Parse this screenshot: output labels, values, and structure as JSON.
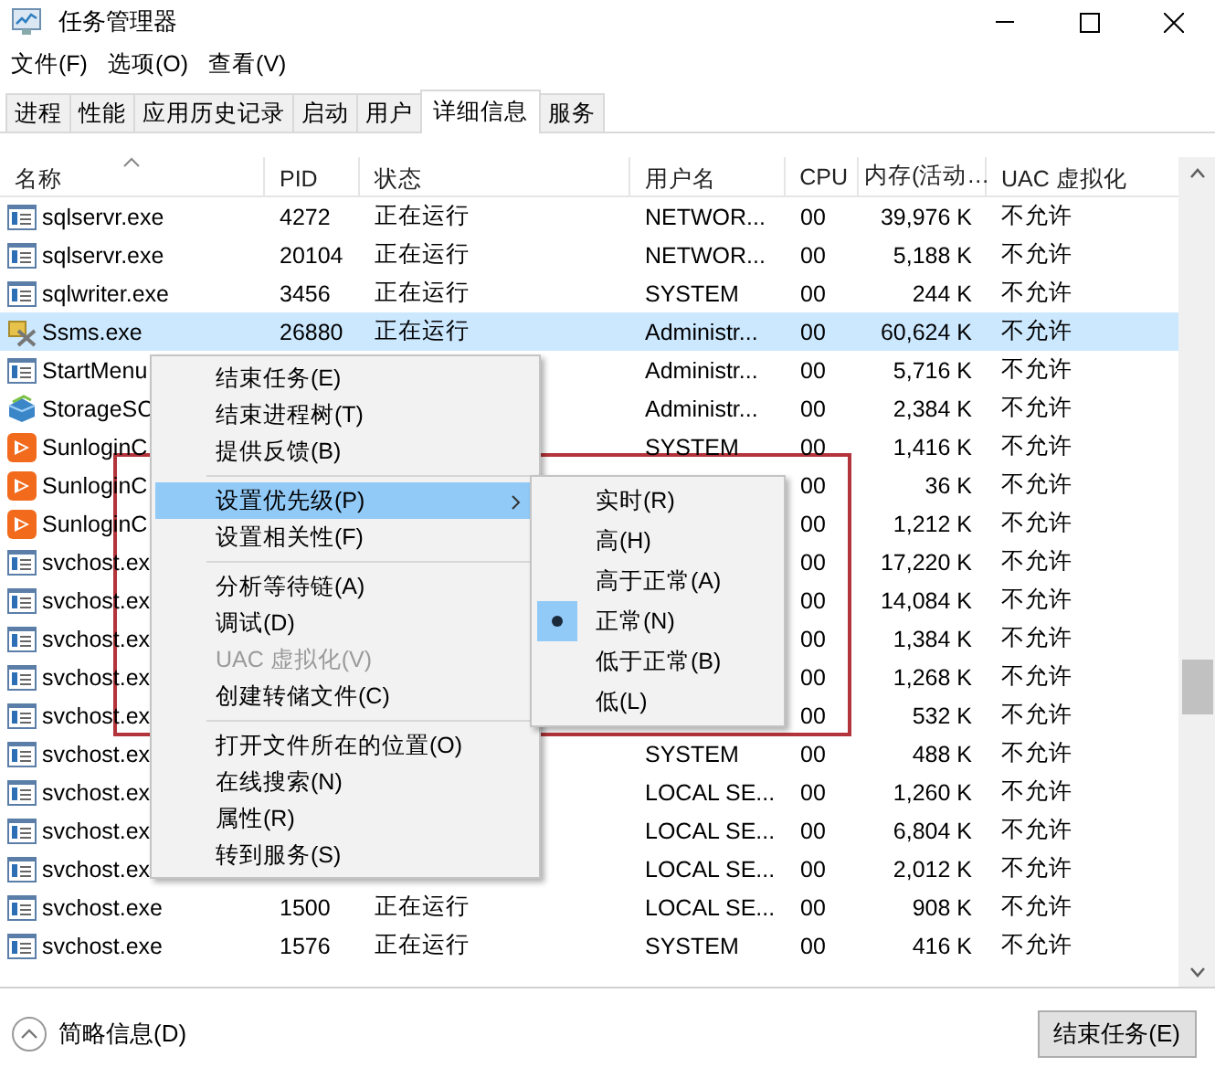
{
  "window": {
    "title": "任务管理器"
  },
  "menu_bar": [
    "文件(F)",
    "选项(O)",
    "查看(V)"
  ],
  "tabs": [
    {
      "label": "进程",
      "selected": false
    },
    {
      "label": "性能",
      "selected": false
    },
    {
      "label": "应用历史记录",
      "selected": false
    },
    {
      "label": "启动",
      "selected": false
    },
    {
      "label": "用户",
      "selected": false
    },
    {
      "label": "详细信息",
      "selected": true
    },
    {
      "label": "服务",
      "selected": false
    }
  ],
  "table": {
    "columns": [
      {
        "label": "名称",
        "sorted": true
      },
      {
        "label": "PID",
        "sorted": false
      },
      {
        "label": "状态",
        "sorted": false
      },
      {
        "label": "用户名",
        "sorted": false
      },
      {
        "label": "CPU",
        "sorted": false
      },
      {
        "label": "内存(活动…",
        "sorted": false
      },
      {
        "label": "UAC 虚拟化",
        "sorted": false
      }
    ],
    "rows": [
      {
        "kind": "service",
        "name": "sqlservr.exe",
        "pid": "4272",
        "status": "正在运行",
        "user": "NETWOR...",
        "cpu": "00",
        "memory": "39,976 K",
        "uac": "不允许",
        "selected": false
      },
      {
        "kind": "service",
        "name": "sqlservr.exe",
        "pid": "20104",
        "status": "正在运行",
        "user": "NETWOR...",
        "cpu": "00",
        "memory": "5,188 K",
        "uac": "不允许",
        "selected": false
      },
      {
        "kind": "service",
        "name": "sqlwriter.exe",
        "pid": "3456",
        "status": "正在运行",
        "user": "SYSTEM",
        "cpu": "00",
        "memory": "244 K",
        "uac": "不允许",
        "selected": false
      },
      {
        "kind": "tools",
        "name": "Ssms.exe",
        "pid": "26880",
        "status": "正在运行",
        "user": "Administr...",
        "cpu": "00",
        "memory": "60,624 K",
        "uac": "不允许",
        "selected": true
      },
      {
        "kind": "service",
        "name": "StartMenu",
        "user": "Administr...",
        "cpu": "00",
        "memory": "5,716 K",
        "uac": "不允许",
        "selected": false
      },
      {
        "kind": "storage",
        "name": "StorageSC",
        "user": "Administr...",
        "cpu": "00",
        "memory": "2,384 K",
        "uac": "不允许",
        "selected": false
      },
      {
        "kind": "sunlogin",
        "name": "SunloginC",
        "user": "SYSTEM",
        "cpu": "00",
        "memory": "1,416 K",
        "uac": "不允许",
        "selected": false
      },
      {
        "kind": "sunlogin",
        "name": "SunloginC",
        "cpu": "00",
        "memory": "36 K",
        "uac": "不允许",
        "selected": false
      },
      {
        "kind": "sunlogin",
        "name": "SunloginC",
        "cpu": "00",
        "memory": "1,212 K",
        "uac": "不允许",
        "selected": false
      },
      {
        "kind": "service",
        "name": "svchost.ex",
        "cpu": "00",
        "memory": "17,220 K",
        "uac": "不允许",
        "selected": false
      },
      {
        "kind": "service",
        "name": "svchost.ex",
        "cpu": "00",
        "memory": "14,084 K",
        "uac": "不允许",
        "selected": false
      },
      {
        "kind": "service",
        "name": "svchost.ex",
        "cpu": "00",
        "memory": "1,384 K",
        "uac": "不允许",
        "selected": false
      },
      {
        "kind": "service",
        "name": "svchost.ex",
        "cpu": "00",
        "memory": "1,268 K",
        "uac": "不允许",
        "selected": false
      },
      {
        "kind": "service",
        "name": "svchost.ex",
        "cpu": "00",
        "memory": "532 K",
        "uac": "不允许",
        "selected": false
      },
      {
        "kind": "service",
        "name": "svchost.ex",
        "user": "SYSTEM",
        "cpu": "00",
        "memory": "488 K",
        "uac": "不允许",
        "selected": false
      },
      {
        "kind": "service",
        "name": "svchost.ex",
        "user": "LOCAL SE...",
        "cpu": "00",
        "memory": "1,260 K",
        "uac": "不允许",
        "selected": false
      },
      {
        "kind": "service",
        "name": "svchost.ex",
        "user": "LOCAL SE...",
        "cpu": "00",
        "memory": "6,804 K",
        "uac": "不允许",
        "selected": false
      },
      {
        "kind": "service",
        "name": "svchost.ex",
        "user": "LOCAL SE...",
        "cpu": "00",
        "memory": "2,012 K",
        "uac": "不允许",
        "selected": false
      },
      {
        "kind": "service",
        "name": "svchost.exe",
        "pid": "1500",
        "status": "正在运行",
        "user": "LOCAL SE...",
        "cpu": "00",
        "memory": "908 K",
        "uac": "不允许",
        "selected": false
      },
      {
        "kind": "service",
        "name": "svchost.exe",
        "pid": "1576",
        "status": "正在运行",
        "user": "SYSTEM",
        "cpu": "00",
        "memory": "416 K",
        "uac": "不允许",
        "selected": false
      }
    ]
  },
  "context_menu": {
    "items": [
      {
        "kind": "command",
        "label": "结束任务(E)",
        "disabled": false,
        "highlighted": false,
        "has_submenu": false
      },
      {
        "kind": "command",
        "label": "结束进程树(T)",
        "disabled": false,
        "highlighted": false,
        "has_submenu": false
      },
      {
        "kind": "command",
        "label": "提供反馈(B)",
        "disabled": false,
        "highlighted": false,
        "has_submenu": false
      },
      {
        "kind": "separator"
      },
      {
        "kind": "command",
        "label": "设置优先级(P)",
        "disabled": false,
        "highlighted": true,
        "has_submenu": true
      },
      {
        "kind": "command",
        "label": "设置相关性(F)",
        "disabled": false,
        "highlighted": false,
        "has_submenu": false
      },
      {
        "kind": "separator"
      },
      {
        "kind": "command",
        "label": "分析等待链(A)",
        "disabled": false,
        "highlighted": false,
        "has_submenu": false
      },
      {
        "kind": "command",
        "label": "调试(D)",
        "disabled": false,
        "highlighted": false,
        "has_submenu": false
      },
      {
        "kind": "command",
        "label": "UAC 虚拟化(V)",
        "disabled": true,
        "highlighted": false,
        "has_submenu": false
      },
      {
        "kind": "command",
        "label": "创建转储文件(C)",
        "disabled": false,
        "highlighted": false,
        "has_submenu": false
      },
      {
        "kind": "separator"
      },
      {
        "kind": "command",
        "label": "打开文件所在的位置(O)",
        "disabled": false,
        "highlighted": false,
        "has_submenu": false
      },
      {
        "kind": "command",
        "label": "在线搜索(N)",
        "disabled": false,
        "highlighted": false,
        "has_submenu": false
      },
      {
        "kind": "command",
        "label": "属性(R)",
        "disabled": false,
        "highlighted": false,
        "has_submenu": false
      },
      {
        "kind": "command",
        "label": "转到服务(S)",
        "disabled": false,
        "highlighted": false,
        "has_submenu": false
      }
    ]
  },
  "priority_submenu": {
    "items": [
      {
        "label": "实时(R)",
        "selected": false
      },
      {
        "label": "高(H)",
        "selected": false
      },
      {
        "label": "高于正常(A)",
        "selected": false
      },
      {
        "label": "正常(N)",
        "selected": true
      },
      {
        "label": "低于正常(B)",
        "selected": false
      },
      {
        "label": "低(L)",
        "selected": false
      }
    ]
  },
  "footer": {
    "details_toggle": "简略信息(D)",
    "end_task_button": "结束任务(E)"
  }
}
